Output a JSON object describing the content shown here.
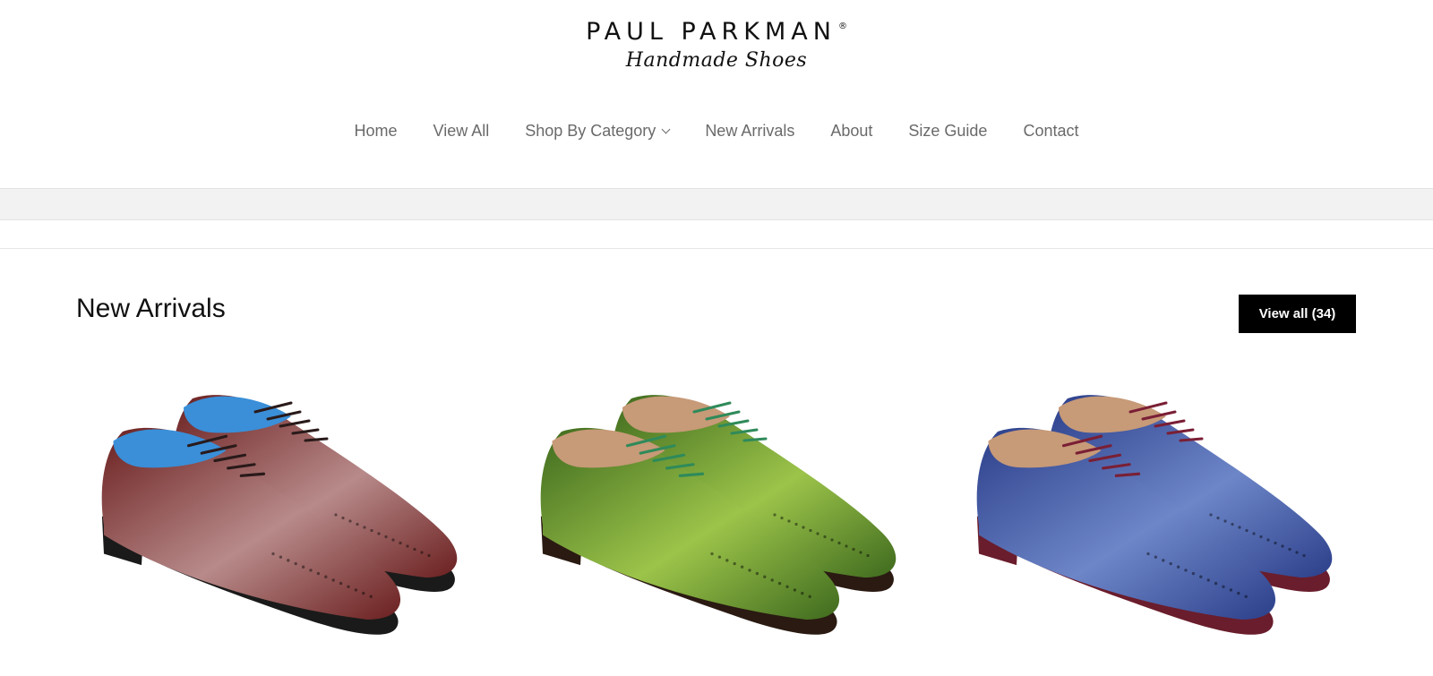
{
  "brand": {
    "name": "PAUL PARKMAN",
    "registered": "®",
    "tagline": "Handmade Shoes"
  },
  "nav": {
    "items": [
      {
        "label": "Home"
      },
      {
        "label": "View All"
      },
      {
        "label": "Shop By Category",
        "icon": "chevron-down-icon"
      },
      {
        "label": "New Arrivals"
      },
      {
        "label": "About"
      },
      {
        "label": "Size Guide"
      },
      {
        "label": "Contact"
      }
    ]
  },
  "section": {
    "title": "New Arrivals",
    "view_all_label": "View all (34)"
  },
  "products": [
    {
      "name": "burgundy-wholecut-oxford",
      "colors": {
        "upper": "#6b1f1f",
        "highlight": "#b88a8a",
        "lining": "#3a8fd8",
        "lace": "#2a1a1a",
        "sole": "#1a1a1a"
      }
    },
    {
      "name": "green-wingtip-derby",
      "colors": {
        "upper": "#3f6a1e",
        "highlight": "#9cc44a",
        "lining": "#c79a78",
        "lace": "#2f8a5a",
        "sole": "#2a1a12"
      }
    },
    {
      "name": "blue-wingtip-derby",
      "colors": {
        "upper": "#2c3f8a",
        "highlight": "#6d86c8",
        "lining": "#c79a78",
        "lace": "#7a1f35",
        "sole": "#6a1d2c"
      }
    }
  ],
  "colors": {
    "nav_text": "#6a6a6a",
    "band": "#f2f2f2",
    "button_bg": "#000000",
    "button_text": "#ffffff"
  }
}
